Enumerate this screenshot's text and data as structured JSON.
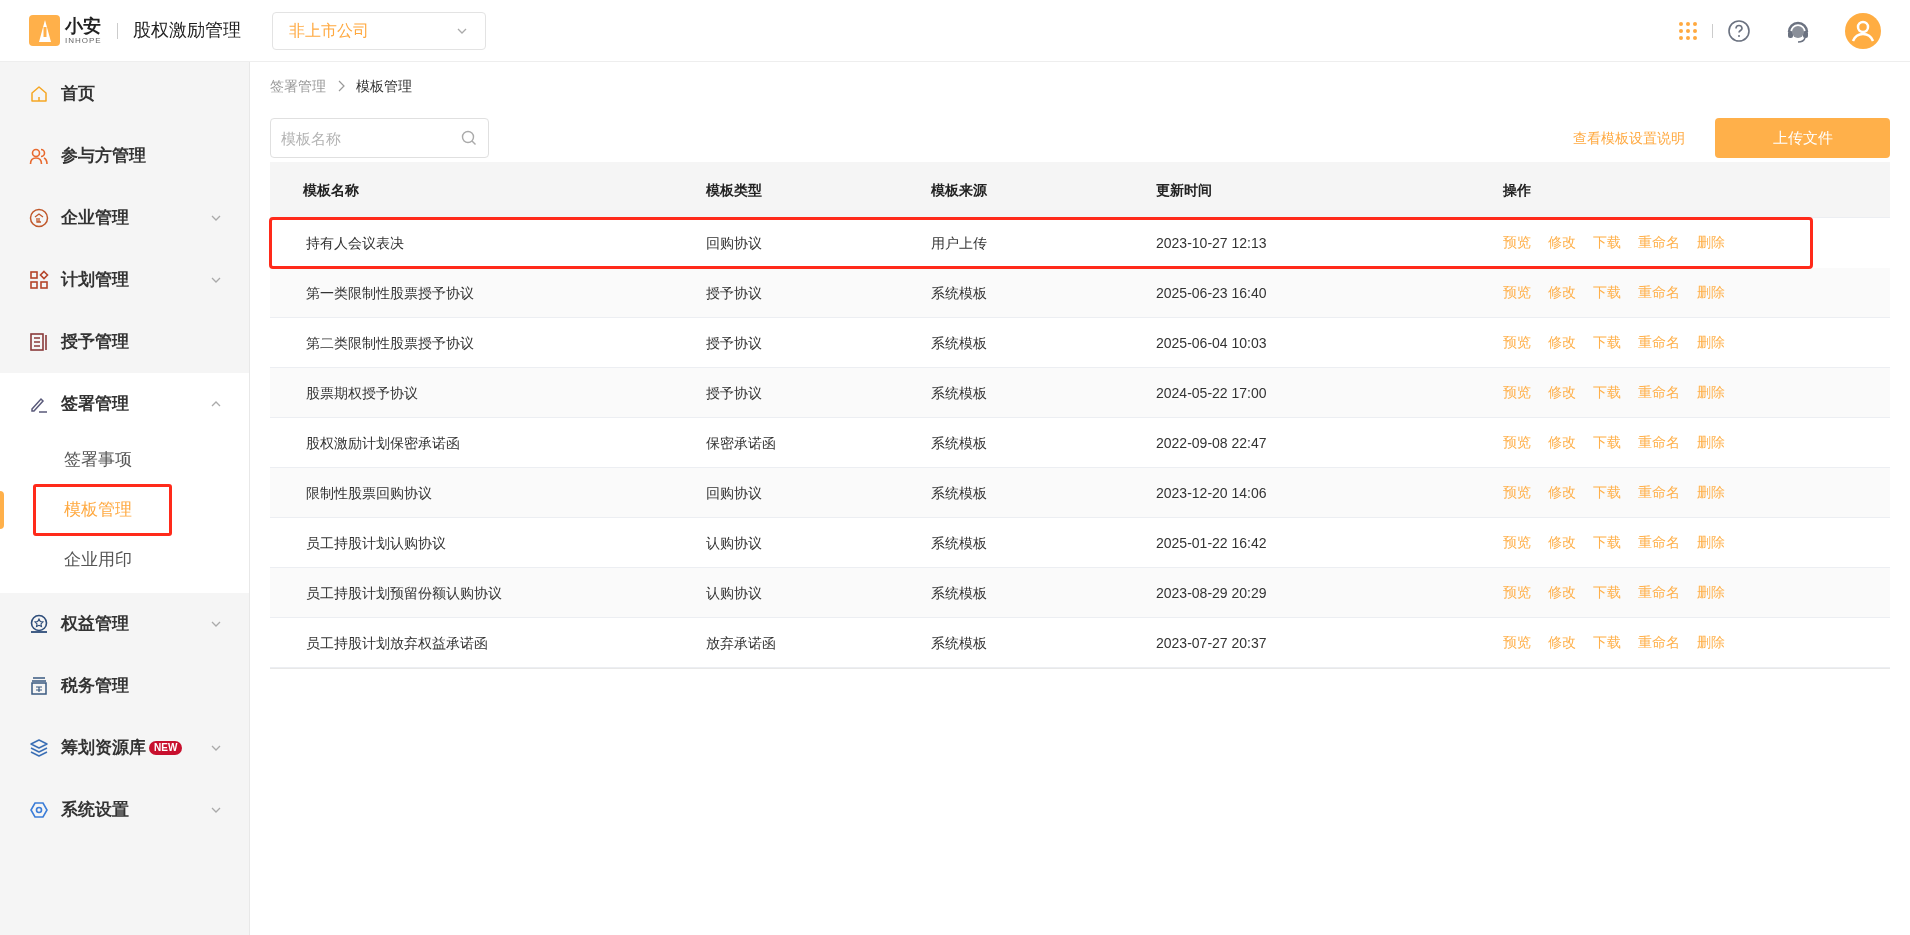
{
  "header": {
    "logo_text": "小安",
    "logo_sub": "INHOPE",
    "title": "股权激励管理",
    "company_select": {
      "value": "非上市公司"
    }
  },
  "sidebar": {
    "items": [
      {
        "label": "首页",
        "selected": false
      },
      {
        "label": "参与方管理",
        "selected": false
      },
      {
        "label": "企业管理",
        "expanded": false,
        "selected": false
      },
      {
        "label": "计划管理",
        "expanded": false,
        "selected": false
      },
      {
        "label": "授予管理",
        "selected": false
      },
      {
        "label": "签署管理",
        "expanded": true,
        "selected": false,
        "children": [
          {
            "label": "签署事项",
            "selected": false,
            "highlighted": false
          },
          {
            "label": "模板管理",
            "selected": true,
            "highlighted": true
          },
          {
            "label": "企业用印",
            "selected": false,
            "highlighted": false
          }
        ]
      },
      {
        "label": "权益管理",
        "expanded": false,
        "selected": false
      },
      {
        "label": "税务管理",
        "selected": false
      },
      {
        "label": "筹划资源库",
        "badge": "NEW",
        "expanded": false,
        "selected": false
      },
      {
        "label": "系统设置",
        "expanded": false,
        "selected": false
      }
    ]
  },
  "breadcrumb": [
    "签署管理",
    "模板管理"
  ],
  "search": {
    "placeholder": "模板名称"
  },
  "help_link": "查看模板设置说明",
  "upload_button": "上传文件",
  "table": {
    "columns": [
      "模板名称",
      "模板类型",
      "模板来源",
      "更新时间",
      "操作"
    ],
    "rows": [
      {
        "name": "持有人会议表决",
        "type": "回购协议",
        "source": "用户上传",
        "updated": "2023-10-27 12:13",
        "actions": [
          "预览",
          "修改",
          "下载",
          "重命名",
          "删除"
        ],
        "highlighted": true
      },
      {
        "name": "第一类限制性股票授予协议",
        "type": "授予协议",
        "source": "系统模板",
        "updated": "2025-06-23 16:40",
        "actions": [
          "预览",
          "修改",
          "下载",
          "重命名",
          "删除"
        ],
        "highlighted": false
      },
      {
        "name": "第二类限制性股票授予协议",
        "type": "授予协议",
        "source": "系统模板",
        "updated": "2025-06-04 10:03",
        "actions": [
          "预览",
          "修改",
          "下载",
          "重命名",
          "删除"
        ],
        "highlighted": false
      },
      {
        "name": "股票期权授予协议",
        "type": "授予协议",
        "source": "系统模板",
        "updated": "2024-05-22 17:00",
        "actions": [
          "预览",
          "修改",
          "下载",
          "重命名",
          "删除"
        ],
        "highlighted": false
      },
      {
        "name": "股权激励计划保密承诺函",
        "type": "保密承诺函",
        "source": "系统模板",
        "updated": "2022-09-08 22:47",
        "actions": [
          "预览",
          "修改",
          "下载",
          "重命名",
          "删除"
        ],
        "highlighted": false
      },
      {
        "name": "限制性股票回购协议",
        "type": "回购协议",
        "source": "系统模板",
        "updated": "2023-12-20 14:06",
        "actions": [
          "预览",
          "修改",
          "下载",
          "重命名",
          "删除"
        ],
        "highlighted": false
      },
      {
        "name": "员工持股计划认购协议",
        "type": "认购协议",
        "source": "系统模板",
        "updated": "2025-01-22 16:42",
        "actions": [
          "预览",
          "修改",
          "下载",
          "重命名",
          "删除"
        ],
        "highlighted": false
      },
      {
        "name": "员工持股计划预留份额认购协议",
        "type": "认购协议",
        "source": "系统模板",
        "updated": "2023-08-29 20:29",
        "actions": [
          "预览",
          "修改",
          "下载",
          "重命名",
          "删除"
        ],
        "highlighted": false
      },
      {
        "name": "员工持股计划放弃权益承诺函",
        "type": "放弃承诺函",
        "source": "系统模板",
        "updated": "2023-07-27 20:37",
        "actions": [
          "预览",
          "修改",
          "下载",
          "重命名",
          "删除"
        ],
        "highlighted": false
      }
    ]
  }
}
